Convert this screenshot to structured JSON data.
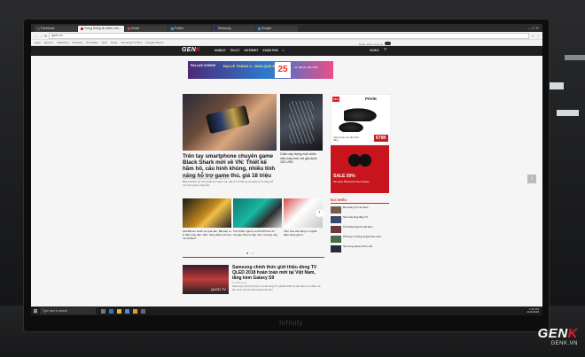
{
  "browser": {
    "tabs": [
      "Facebook",
      "Trong thông tin dành cho...",
      "Gmail",
      "Twitter",
      "Samsung",
      "Google"
    ],
    "url": "genk.vn",
    "bookmarks": [
      "Apps",
      "genk.vn",
      "Marketing",
      "Software",
      "PC Media",
      "Tech",
      "News",
      "Samsung TV Plus",
      "Google Photos"
    ]
  },
  "site": {
    "logo_prefix": "GEN",
    "logo_suffix": "K",
    "menu": [
      "MOBILE",
      "TIN ICT",
      "INTERNET",
      "KHÁM PHÁ",
      "≡"
    ],
    "video": "VIDEO",
    "login": "Đăng nhập với genk"
  },
  "banner": {
    "brand": "PALLAS CHOICE",
    "headline": "ĐẠI LỄ THÁNG 4 - MUA QUÀ SANG",
    "day": "25",
    "sub": "Ưu đãi lên đến 50%"
  },
  "hero": {
    "title": "Trên tay smartphone chuyên game Black Shark mới về VN: Thiết kế hầm hố, cấu hình khủng, nhiều tính năng hỗ trợ game thủ, giá 18 triệu",
    "meta": "Black Shark - smartphone gaming của Xiaomi",
    "sapo": "Black Shark sở hữu thiết kế mạnh mẽ, cấu hình khủng và nhiều tính năng hỗ trợ chơi game hấp dẫn."
  },
  "side_story": {
    "title": "Cách xây dựng một chiếc xiếc máy tính với giá dưới 150 USD"
  },
  "row2": [
    {
      "caption": "Giá Bitcoin Cash lọt quá sàn, Bitmain ra lò đầu máy đào \"độc\" dùng điện mà hoá mỏ đi đâu?"
    },
    {
      "caption": "Với nhiều người so bởi iPhone rồi Google Pixel 3 đẹp như concept này"
    },
    {
      "caption": "Tiền hoa văn động vì nghĩa điện thoại giá rẻ"
    }
  ],
  "news": {
    "badge": "QLED TV",
    "title": "Samsung chính thức giới thiệu dòng TV QLED 2018 hoàn toàn mới tại Việt Nam, tăng kèm Galaxy S9",
    "meta": "Tin quảng cáo",
    "sapo": "Samsung vừa chính thức ra mắt dòng TV QLED 2018 tại Việt Nam với nhiều cải tiến vượt trội về chất lượng hình ảnh."
  },
  "ad_pavik": {
    "discount": "25%",
    "brand": "PAVIK",
    "price": "679K",
    "text": "Giày da nam cao cấp chính hãng"
  },
  "ad_sale": {
    "headline": "SALE 50%",
    "sub": "Tai nghe Bluetooth Sennheiser"
  },
  "hot": {
    "heading": "ĐỌC NHIỀU",
    "items": [
      "Bùi Hoàng Vũ cán đoán",
      "Siêu Việt cộng đồng TV",
      "Thời khắc Esports Việt Nam",
      "Phát hay từ thông số giá Pixel Land",
      "Samsung Galaxy S9 ra mắt"
    ]
  },
  "taskbar": {
    "start": "⊞",
    "search": "Type here to search",
    "time": "1:52 PM",
    "date": "4/24/2018"
  },
  "monitor_brand": "Infinity",
  "watermark": {
    "big_prefix": "GEN",
    "big_suffix": "K",
    "small": "GENK.VN"
  }
}
